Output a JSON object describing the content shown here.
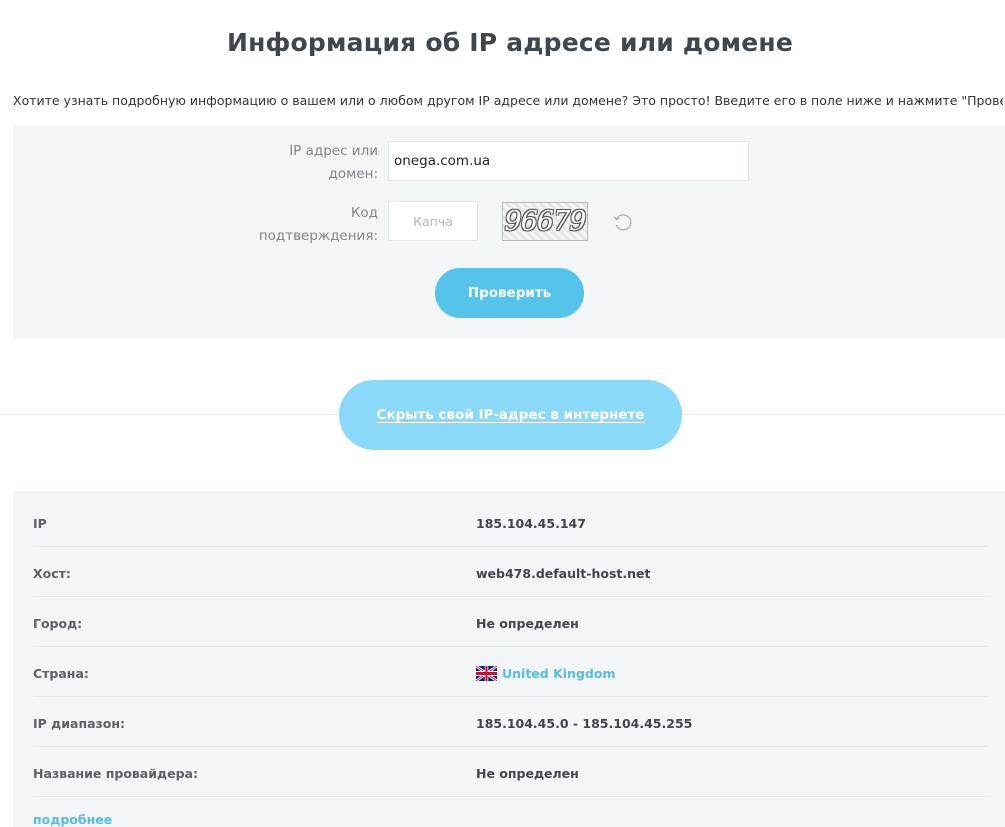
{
  "page_title": "Информация об IP адресе или домене",
  "intro_text": "Хотите узнать подробную информацию о вашем или о любом другом IP адресе или домене? Это просто! Введите его в поле ниже и нажмите \"Проверить\".",
  "form": {
    "ip_label_line1": "IP адрес или",
    "ip_label_line2": "домен:",
    "ip_value": "onega.com.ua",
    "code_label_line1": "Код",
    "code_label_line2": "подтверждения:",
    "captcha_placeholder": "Капча",
    "captcha_text": "96679",
    "refresh_icon": "refresh-icon",
    "submit_label": "Проверить"
  },
  "hide_ip_label": "Скрыть свой IP-адрес в интернете",
  "results": [
    {
      "label": "IP",
      "value": "185.104.45.147"
    },
    {
      "label": "Хост:",
      "value": "web478.default-host.net"
    },
    {
      "label": "Город:",
      "value": "Не определен"
    },
    {
      "label": "Страна:",
      "value": "United Kingdom",
      "flag_icon": "uk-flag-icon"
    },
    {
      "label": "IP диапазон:",
      "value": "185.104.45.0 - 185.104.45.255"
    },
    {
      "label": "Название провайдера:",
      "value": "Не определен"
    }
  ],
  "more_link": "подробнее",
  "colors": {
    "accent": "#55c4ea",
    "hide_button": "#8ad9f9",
    "link": "#55bde6",
    "panel_bg": "#f3f6f7"
  }
}
